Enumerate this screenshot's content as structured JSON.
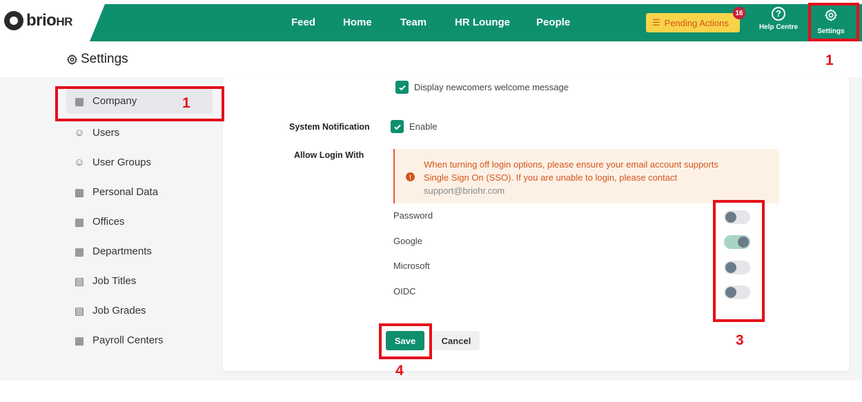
{
  "app": {
    "logo_main": "brio",
    "logo_suffix": "HR"
  },
  "nav": {
    "items": [
      "Feed",
      "Home",
      "Team",
      "HR Lounge",
      "People"
    ],
    "pending_label": "Pending Actions",
    "pending_count": "16",
    "help_label": "Help Centre",
    "settings_label": "Settings"
  },
  "page": {
    "title": "Settings"
  },
  "sidebar": {
    "items": [
      {
        "label": "Company",
        "icon": "building-icon",
        "active": true
      },
      {
        "label": "Users",
        "icon": "users-icon"
      },
      {
        "label": "User Groups",
        "icon": "users-icon"
      },
      {
        "label": "Personal Data",
        "icon": "id-card-icon"
      },
      {
        "label": "Offices",
        "icon": "building-icon"
      },
      {
        "label": "Departments",
        "icon": "building-icon"
      },
      {
        "label": "Job Titles",
        "icon": "briefcase-icon"
      },
      {
        "label": "Job Grades",
        "icon": "briefcase-icon"
      },
      {
        "label": "Payroll Centers",
        "icon": "building-icon"
      }
    ]
  },
  "form": {
    "newcomers_label": "Display newcomers welcome message",
    "system_notification_label": "System Notification",
    "enable_label": "Enable",
    "allow_login_label": "Allow Login With",
    "warning_line1": "When turning off login options, please ensure your email account supports",
    "warning_line2": "Single Sign On (SSO). If you are unable to login, please contact",
    "warning_email": "support@briohr.com",
    "login_options": [
      {
        "label": "Password",
        "enabled": false
      },
      {
        "label": "Google",
        "enabled": true
      },
      {
        "label": "Microsoft",
        "enabled": false
      },
      {
        "label": "OIDC",
        "enabled": false
      }
    ],
    "save_label": "Save",
    "cancel_label": "Cancel"
  },
  "annotations": {
    "settings_step": "1",
    "company_step": "1",
    "toggles_step": "3",
    "save_step": "4"
  },
  "colors": {
    "brand_green": "#0e8f6e",
    "pending_yellow": "#f8d34a",
    "annotation_red": "#e5101b",
    "warning_orange": "#d4561a"
  }
}
